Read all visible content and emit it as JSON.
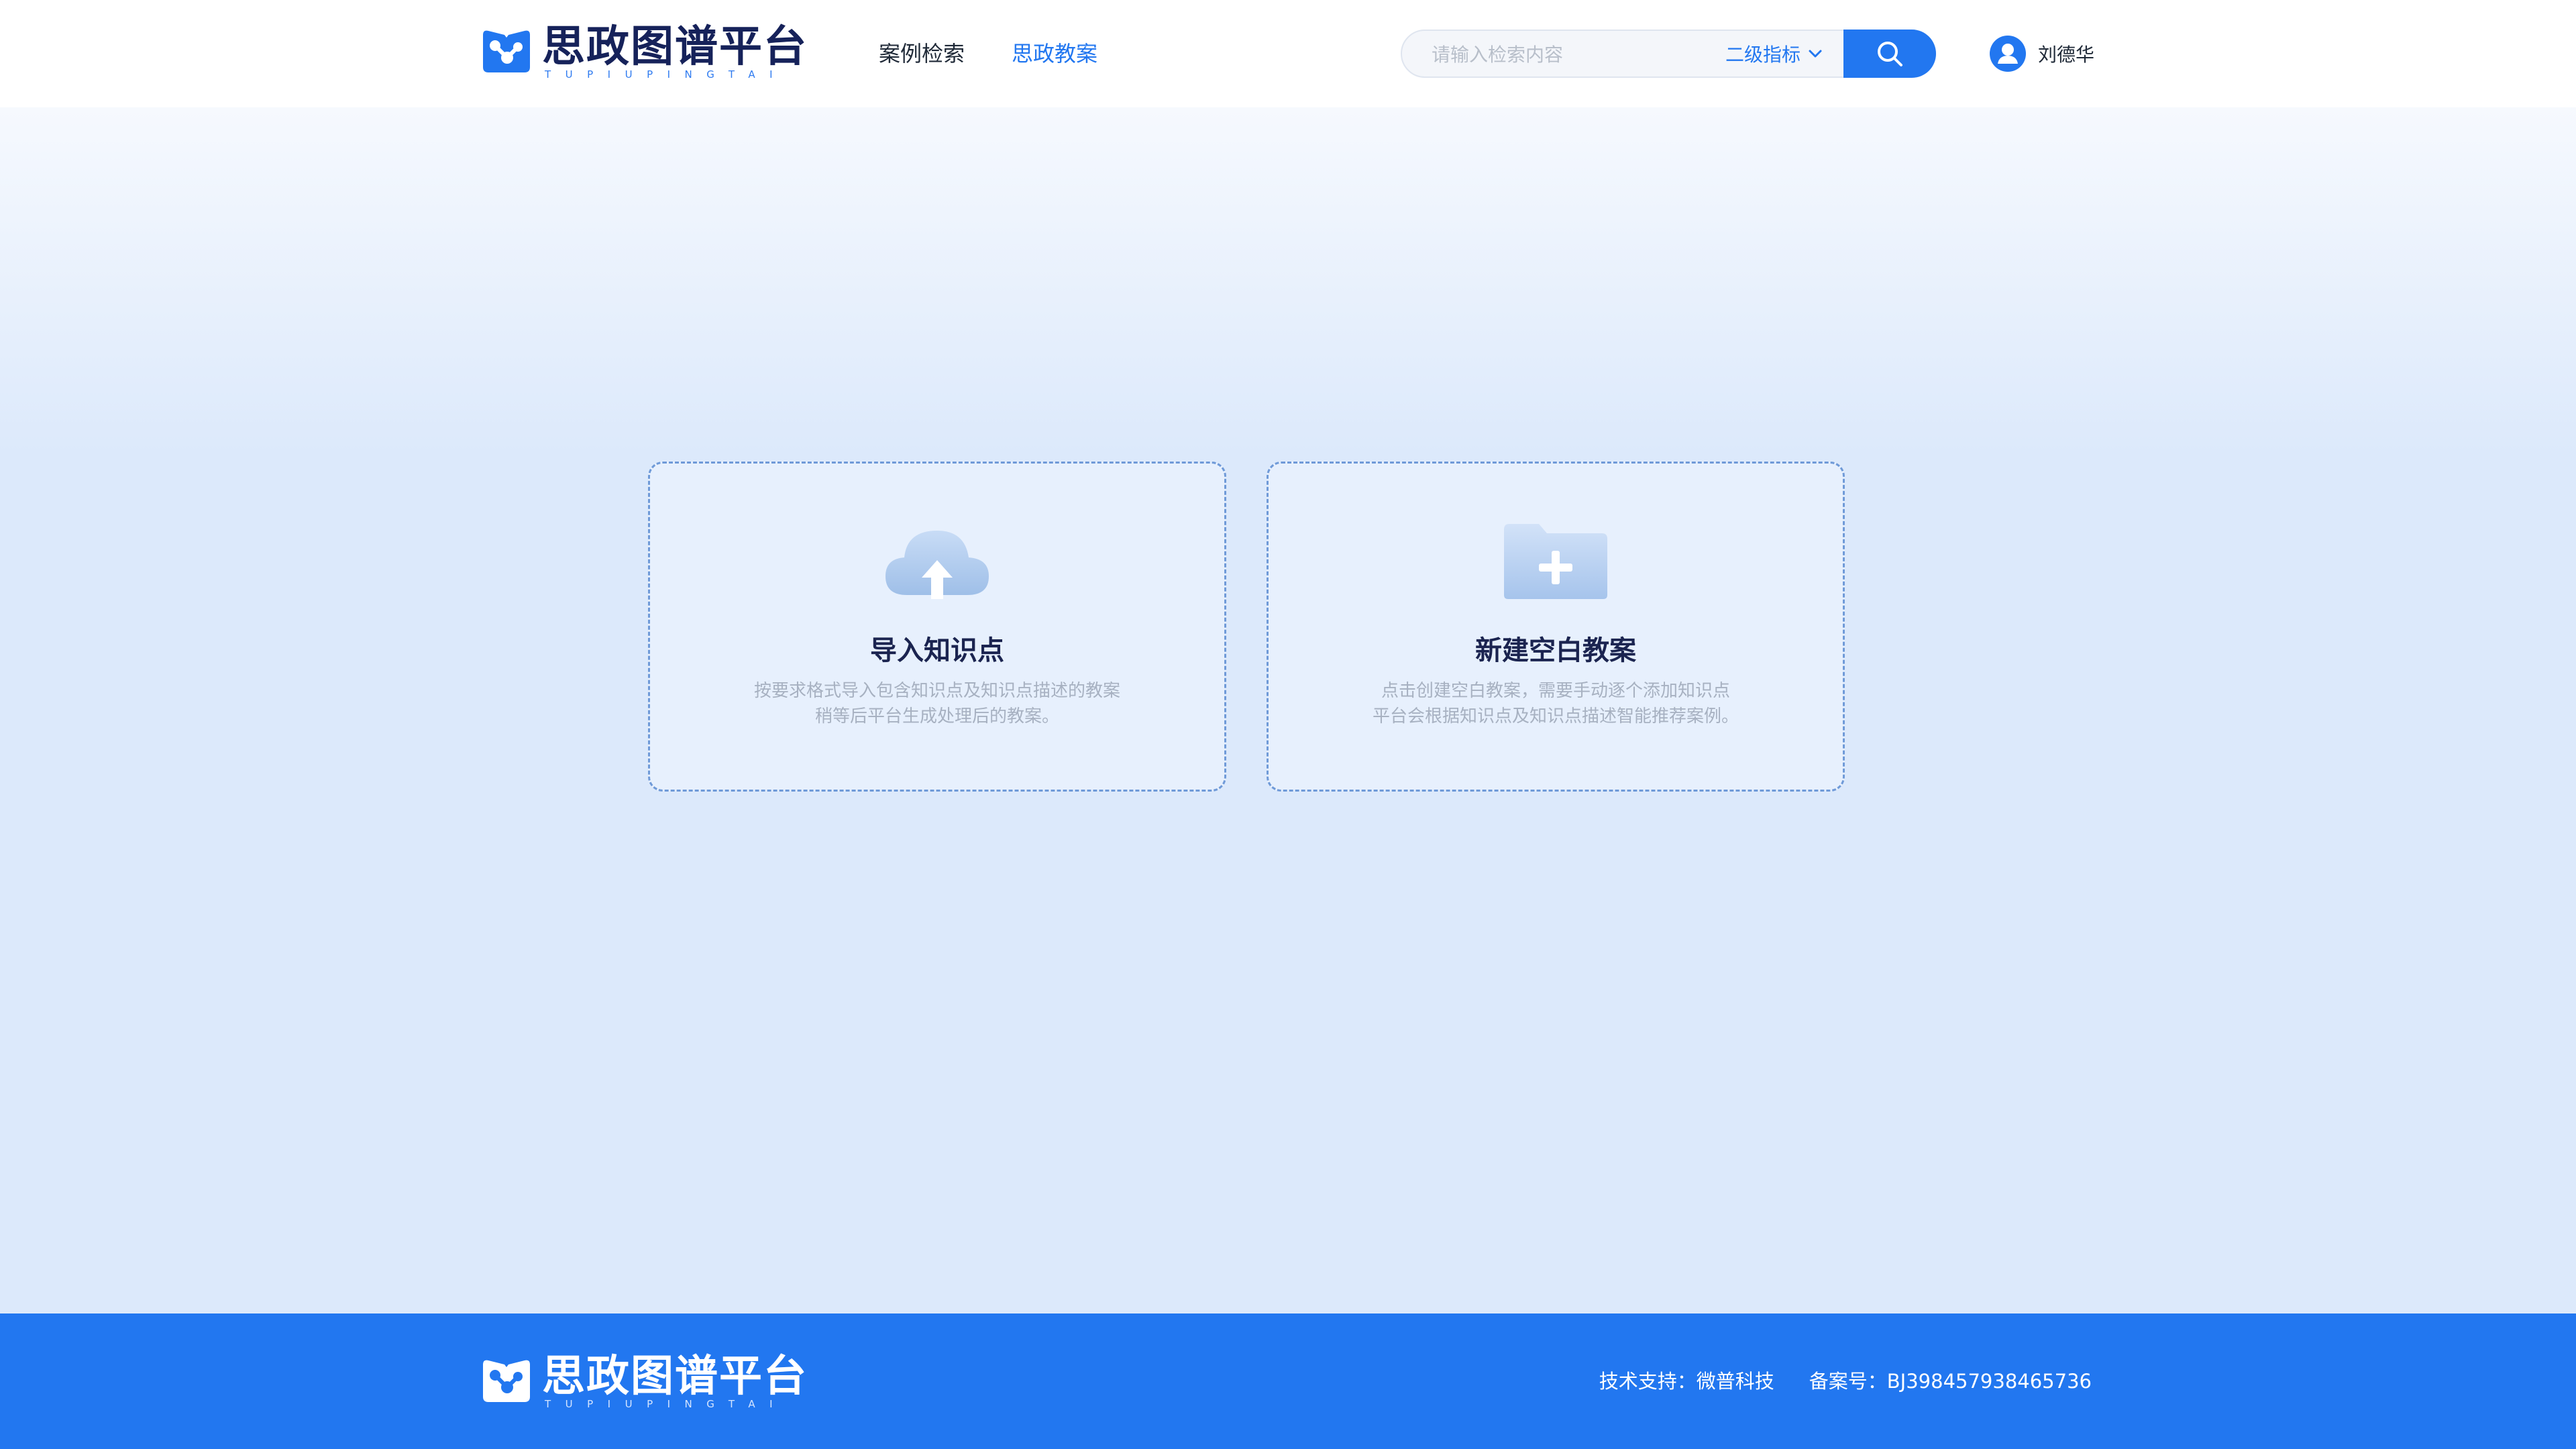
{
  "brand": {
    "title": "思政图谱平台",
    "subtitle": "TUPIUPINGTAI",
    "icon": "brand-graph-book-icon",
    "colors": {
      "primary": "#2277f0",
      "navy": "#16225a"
    }
  },
  "nav": {
    "items": [
      {
        "label": "案例检索",
        "active": false
      },
      {
        "label": "思政教案",
        "active": true
      }
    ]
  },
  "search": {
    "placeholder": "请输入检索内容",
    "value": "",
    "select_label": "二级指标",
    "select_icon": "chevron-down-icon",
    "button_icon": "search-icon"
  },
  "user": {
    "name": "刘德华",
    "avatar_icon": "user-avatar-icon"
  },
  "cards": [
    {
      "icon": "cloud-upload-icon",
      "title": "导入知识点",
      "desc_line1": "按要求格式导入包含知识点及知识点描述的教案",
      "desc_line2": "稍等后平台生成处理后的教案。"
    },
    {
      "icon": "folder-add-icon",
      "title": "新建空白教案",
      "desc_line1": "点击创建空白教案，需要手动逐个添加知识点",
      "desc_line2": "平台会根据知识点及知识点描述智能推荐案例。"
    }
  ],
  "footer": {
    "brand_title": "思政图谱平台",
    "brand_subtitle": "TUPIUPINGTAI",
    "support": "技术支持：微普科技",
    "record": "备案号：BJ398457938465736"
  }
}
